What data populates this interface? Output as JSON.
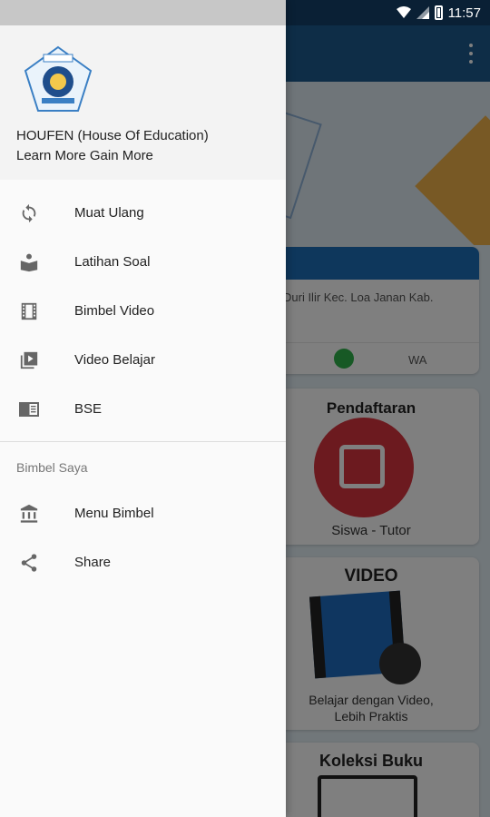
{
  "status_bar": {
    "time": "11:57"
  },
  "drawer": {
    "header": {
      "title": "HOUFEN (House Of Education)",
      "subtitle": "Learn More Gain More",
      "logo_icon": "houfen-logo"
    },
    "primary_items": [
      {
        "label": "Muat Ulang",
        "icon": "refresh-icon"
      },
      {
        "label": "Latihan Soal",
        "icon": "reading-icon"
      },
      {
        "label": "Bimbel Video",
        "icon": "film-icon"
      },
      {
        "label": "Video Belajar",
        "icon": "video-library-icon"
      },
      {
        "label": "BSE",
        "icon": "book-open-icon"
      }
    ],
    "section_title": "Bimbel Saya",
    "secondary_items": [
      {
        "label": "Menu Bimbel",
        "icon": "institution-icon"
      },
      {
        "label": "Share",
        "icon": "share-icon"
      }
    ]
  },
  "background": {
    "info_card": {
      "address": "Duri Ilir Kec. Loa Janan Kab.",
      "whatsapp_label": "WA"
    },
    "register_card": {
      "title": "Pendaftaran",
      "subtitle": "Siswa - Tutor"
    },
    "video_card": {
      "title": "VIDEO",
      "subtitle_line1": "Belajar dengan Video,",
      "subtitle_line2": "Lebih Praktis"
    },
    "books_card": {
      "title": "Koleksi Buku"
    }
  },
  "colors": {
    "app_bar": "#1d5a8e",
    "status_bar": "#15406a",
    "register_circle": "#d9343f",
    "whatsapp": "#2fb24a",
    "drawer_bg": "#fafafa",
    "header_bg": "#f3f3f3"
  }
}
